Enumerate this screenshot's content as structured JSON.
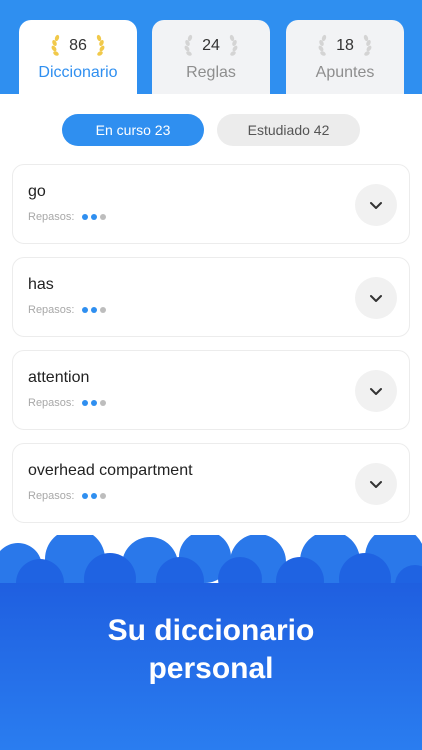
{
  "tabs": [
    {
      "count": "86",
      "label": "Diccionario",
      "active": true
    },
    {
      "count": "24",
      "label": "Reglas",
      "active": false
    },
    {
      "count": "18",
      "label": "Apuntes",
      "active": false
    }
  ],
  "segments": {
    "in_progress": "En curso 23",
    "studied": "Estudiado 42"
  },
  "cards": [
    {
      "word": "go",
      "reviews_label": "Repasos:",
      "progress": {
        "filled": 2,
        "total": 3
      }
    },
    {
      "word": "has",
      "reviews_label": "Repasos:",
      "progress": {
        "filled": 2,
        "total": 3
      }
    },
    {
      "word": "attention",
      "reviews_label": "Repasos:",
      "progress": {
        "filled": 2,
        "total": 3
      }
    },
    {
      "word": "overhead compartment",
      "reviews_label": "Repasos:",
      "progress": {
        "filled": 2,
        "total": 3
      }
    }
  ],
  "banner": {
    "line1": "Su diccionario",
    "line2": "personal"
  },
  "colors": {
    "accent": "#2f8ff0",
    "laurel_active": "#f1c94a",
    "laurel_inactive": "#d4d4d4",
    "banner": "#1f66e5"
  },
  "icons": {
    "tab_decoration": "laurel-icon",
    "expand": "chevron-down-icon"
  }
}
